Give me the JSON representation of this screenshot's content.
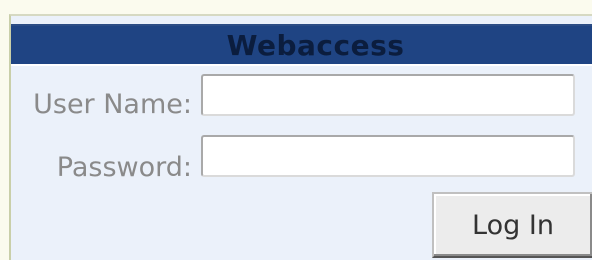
{
  "login_panel": {
    "title": "Webaccess",
    "username_label": "User Name:",
    "username_value": "",
    "password_label": "Password:",
    "password_value": "",
    "login_button_label": "Log In"
  }
}
